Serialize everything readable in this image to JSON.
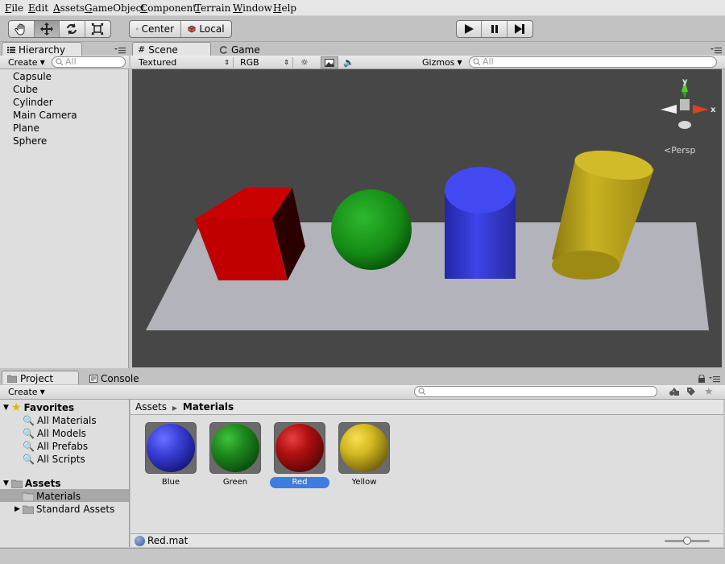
{
  "menu": [
    "File",
    "Edit",
    "Assets",
    "GameObject",
    "Component",
    "Terrain",
    "Window",
    "Help"
  ],
  "toolbar": {
    "tools": [
      "hand-tool",
      "move-tool",
      "rotate-tool",
      "scale-tool"
    ],
    "pivot_label": "Center",
    "space_label": "Local",
    "playback": [
      "play",
      "pause",
      "step"
    ]
  },
  "hierarchy": {
    "tab_label": "Hierarchy",
    "create_label": "Create",
    "search_placeholder": "All",
    "items": [
      "Capsule",
      "Cube",
      "Cylinder",
      "Main Camera",
      "Plane",
      "Sphere"
    ]
  },
  "scene": {
    "tabs": [
      "Scene",
      "Game"
    ],
    "render_mode": "Textured",
    "color_mode": "RGB",
    "gizmos_label": "Gizmos",
    "search_placeholder": "All",
    "gizmo_axes": {
      "y": "y",
      "x": "x"
    },
    "persp_label": "Persp"
  },
  "project": {
    "tabs": [
      "Project",
      "Console"
    ],
    "create_label": "Create",
    "favorites_label": "Favorites",
    "favorites": [
      "All Materials",
      "All Models",
      "All Prefabs",
      "All Scripts"
    ],
    "assets_label": "Assets",
    "folders": [
      "Materials",
      "Standard Assets"
    ],
    "breadcrumb": {
      "root": "Assets",
      "separator": "▶",
      "current": "Materials"
    },
    "materials": [
      {
        "name": "Blue",
        "color": "#3b40d8"
      },
      {
        "name": "Green",
        "color": "#1e8a1e"
      },
      {
        "name": "Red",
        "color": "#b01010"
      },
      {
        "name": "Yellow",
        "color": "#d2b820"
      }
    ],
    "selected_material": "Red",
    "selected_file": "Red.mat",
    "thumbnail_scale": 0.5
  }
}
